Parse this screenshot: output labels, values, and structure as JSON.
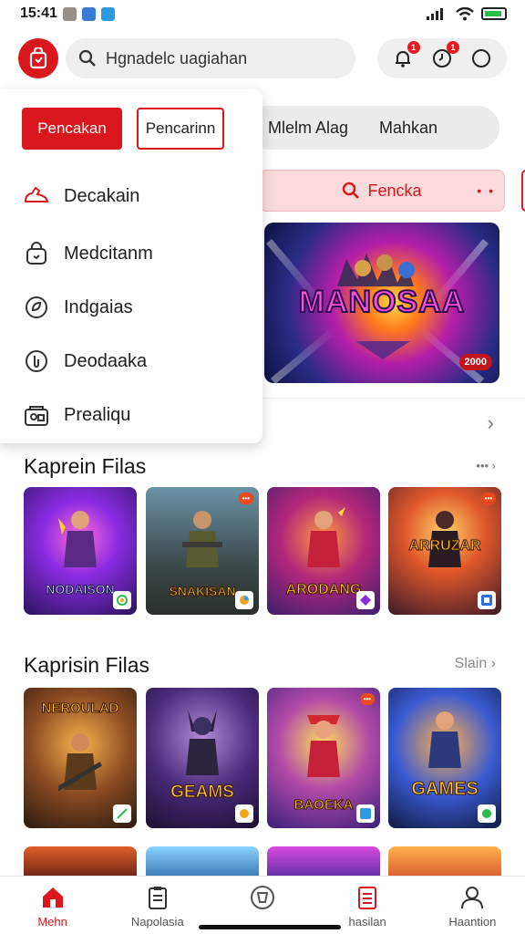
{
  "status_bar": {
    "time": "15:41"
  },
  "header": {
    "search_placeholder": "Hgnadelc uagiahan",
    "notification_badge": "1",
    "clock_badge": "1"
  },
  "menu": {
    "primary_button": "Pencakan",
    "secondary_button": "Pencarinn",
    "items": [
      {
        "label": "Decakain",
        "icon": "shoe-icon"
      },
      {
        "label": "Medcitanm",
        "icon": "bag-icon"
      },
      {
        "label": "Indgaias",
        "icon": "leaf-circle-icon"
      },
      {
        "label": "Deodaaka",
        "icon": "info-circle-icon"
      },
      {
        "label": "Prealiqu",
        "icon": "storefront-icon"
      }
    ]
  },
  "background": {
    "tabs": [
      "Mlelm Alag",
      "Mahkan"
    ],
    "search_button": "Fencka",
    "banner_title": "MANOSAA",
    "banner_tag": "2000"
  },
  "sections": [
    {
      "title": "Kaprein Filas",
      "more": "",
      "games": [
        {
          "title": "NODAISON",
          "tag": ""
        },
        {
          "title": "SNAKISAN",
          "tag": ""
        },
        {
          "title": "ARODANG",
          "tag": ""
        },
        {
          "title": "ARRUZAR",
          "tag": ""
        }
      ]
    },
    {
      "title": "Kaprisin Filas",
      "more": "Slain",
      "games": [
        {
          "title": "NEROULAD",
          "tag": ""
        },
        {
          "title": "GEAMS",
          "tag": ""
        },
        {
          "title": "BAOEKA",
          "tag": ""
        },
        {
          "title": "GAMES",
          "tag": ""
        }
      ]
    }
  ],
  "bottom_nav": [
    {
      "label": "Mehn",
      "icon": "home-icon",
      "active": true
    },
    {
      "label": "Napolasia",
      "icon": "clipboard-icon",
      "active": false
    },
    {
      "label": "",
      "icon": "shield-icon",
      "active": false
    },
    {
      "label": "hasilan",
      "icon": "list-icon",
      "active": false
    },
    {
      "label": "Haantion",
      "icon": "profile-icon",
      "active": false
    }
  ],
  "colors": {
    "brand": "#d9171c",
    "badge": "#e31b23"
  }
}
